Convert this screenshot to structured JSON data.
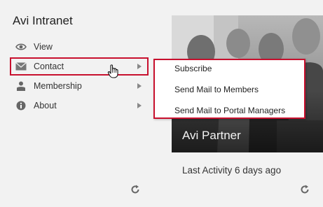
{
  "app": {
    "title": "Avi Intranet"
  },
  "menu": {
    "items": [
      {
        "label": "View",
        "icon": "eye-icon",
        "has_submenu": false
      },
      {
        "label": "Contact",
        "icon": "envelope-icon",
        "has_submenu": true,
        "highlighted": true
      },
      {
        "label": "Membership",
        "icon": "person-icon",
        "has_submenu": true
      },
      {
        "label": "About",
        "icon": "info-icon",
        "has_submenu": true
      }
    ]
  },
  "submenu": {
    "items": [
      {
        "label": "Subscribe"
      },
      {
        "label": "Send Mail to Members"
      },
      {
        "label": "Send Mail to Portal Managers"
      }
    ]
  },
  "card": {
    "label": "Avi Partner",
    "last_activity": "Last Activity 6 days ago"
  },
  "colors": {
    "highlight_border": "#c8102e",
    "background": "#f2f2f2"
  }
}
